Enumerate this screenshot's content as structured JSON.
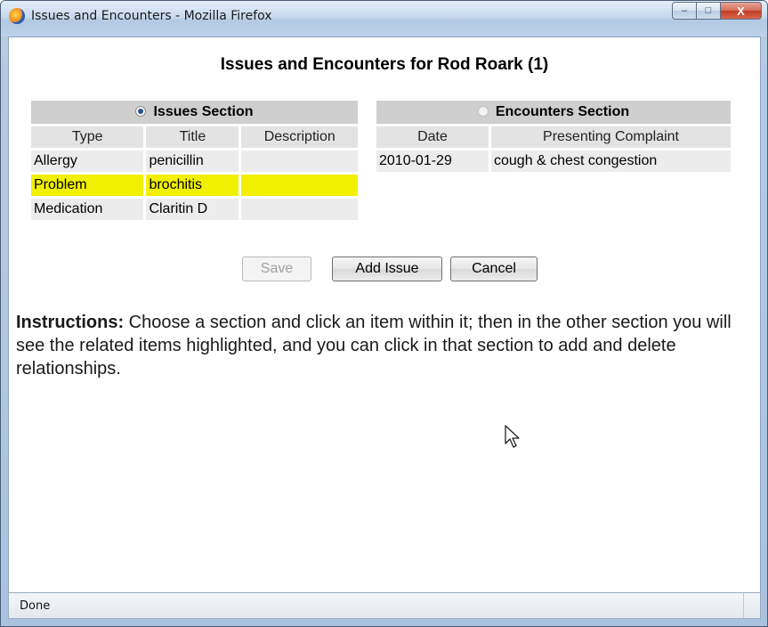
{
  "window": {
    "title": "Issues and Encounters - Mozilla Firefox",
    "minimize_glyph": "–",
    "maximize_glyph": "□",
    "close_glyph": "X"
  },
  "page": {
    "heading": "Issues and Encounters for Rod Roark (1)"
  },
  "issues": {
    "section_label": "Issues Section",
    "selected": true,
    "columns": [
      "Type",
      "Title",
      "Description"
    ],
    "rows": [
      {
        "type": "Allergy",
        "title": "penicillin",
        "description": "",
        "highlighted": false
      },
      {
        "type": "Problem",
        "title": "brochitis",
        "description": "",
        "highlighted": true
      },
      {
        "type": "Medication",
        "title": "Claritin D",
        "description": "",
        "highlighted": false
      }
    ]
  },
  "encounters": {
    "section_label": "Encounters Section",
    "selected": false,
    "columns": [
      "Date",
      "Presenting Complaint"
    ],
    "rows": [
      {
        "date": "2010-01-29",
        "complaint": "cough & chest congestion"
      }
    ]
  },
  "buttons": {
    "save": "Save",
    "save_disabled": true,
    "add_issue": "Add Issue",
    "cancel": "Cancel"
  },
  "instructions": {
    "label": "Instructions:",
    "text": " Choose a section and click an item within it; then in the other section you will see the related items highlighted, and you can click in that section to add and delete relationships."
  },
  "status": {
    "text": "Done"
  },
  "colors": {
    "highlight": "#f0f000",
    "section_header": "#cfcfcf",
    "column_header": "#e3e3e3",
    "cell": "#ececec"
  }
}
